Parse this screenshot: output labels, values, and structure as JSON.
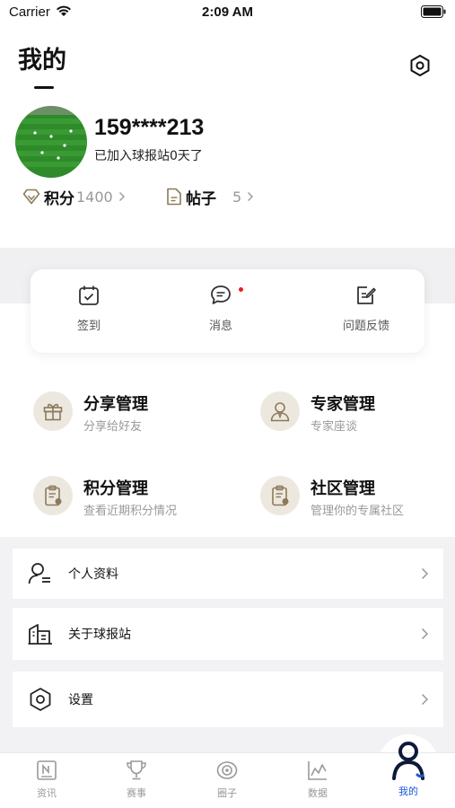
{
  "status_bar": {
    "carrier": "Carrier",
    "time": "2:09 AM"
  },
  "header": {
    "title": "我的"
  },
  "profile": {
    "username": "159****213",
    "joined_text": "已加入球报站0天了"
  },
  "stats": {
    "points_label": "积分",
    "points_value": "1400",
    "posts_label": "帖子",
    "posts_value": "5"
  },
  "quick_actions": [
    {
      "label": "签到",
      "icon": "calendar-check-icon"
    },
    {
      "label": "消息",
      "icon": "chat-bubble-icon"
    },
    {
      "label": "问题反馈",
      "icon": "edit-note-icon"
    }
  ],
  "management": [
    {
      "title": "分享管理",
      "subtitle": "分享给好友",
      "icon": "gift-icon"
    },
    {
      "title": "专家管理",
      "subtitle": "专家座谈",
      "icon": "expert-icon"
    },
    {
      "title": "积分管理",
      "subtitle": "查看近期积分情况",
      "icon": "clipboard-icon"
    },
    {
      "title": "社区管理",
      "subtitle": "管理你的专属社区",
      "icon": "clipboard-icon"
    }
  ],
  "menu": [
    {
      "label": "个人资料",
      "icon": "user-profile-icon"
    },
    {
      "label": "关于球报站",
      "icon": "building-icon"
    },
    {
      "label": "设置",
      "icon": "settings-hex-icon"
    }
  ],
  "tabbar": [
    {
      "label": "资讯",
      "icon": "news-icon"
    },
    {
      "label": "赛事",
      "icon": "trophy-icon"
    },
    {
      "label": "圈子",
      "icon": "circle-icon"
    },
    {
      "label": "数据",
      "icon": "chart-icon"
    },
    {
      "label": "我的",
      "icon": "person-icon",
      "active": true
    }
  ],
  "colors": {
    "accent": "#1a56d6",
    "dot": "#e52020",
    "mgmt_circle": "#ede8df",
    "band": "#f0f0f2"
  }
}
